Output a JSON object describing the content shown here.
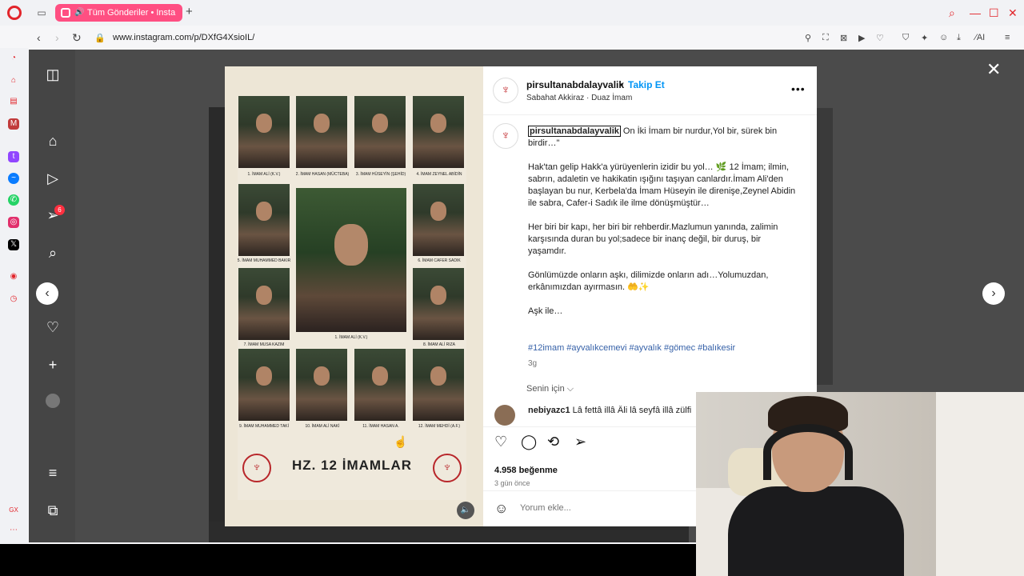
{
  "browser": {
    "tab_title": "Tüm Gönderiler • Insta",
    "url": "www.instagram.com/p/DXfG4XsioIL/",
    "ext_ai_label": "AI",
    "new_tab": "+",
    "notif_badge": "6"
  },
  "post": {
    "username": "pirsultanabdalayvalik",
    "follow_label": "Takip Et",
    "separator": "•",
    "subtitle": "Sabahat Akkiraz · Duaz İmam",
    "caption_start": "On İki İmam bir nurdur,Yol bir, sürek bin birdir…\"",
    "p1": "Hak'tan gelip Hakk'a yürüyenlerin izidir bu yol… 🌿 12 İmam; ilmin, sabrın, adaletin ve hakikatin ışığını taşıyan canlardır.İmam Ali'den başlayan bu nur, Kerbela'da İmam Hüseyin ile direnişe,Zeynel Abidin ile sabra, Cafer-i Sadık ile ilme dönüşmüştür…",
    "p2": "Her biri bir kapı, her biri bir rehberdir.Mazlumun yanında, zalimin karşısında duran bu yol;sadece bir inanç değil, bir duruş, bir yaşamdır.",
    "p3": "Gönlümüzde onların aşkı, dilimizde onların adı…Yolumuzdan, erkânımızdan ayırmasın. 🤲✨",
    "p4": "Aşk ile…",
    "hashtags": "#12imam #ayvalıkcemevi #ayvalık #gömec #balıkesir",
    "age": "3g",
    "for_you": "Senin için ⌵",
    "comment_user": "nebiyazc1",
    "comment_text": "Lâ fettâ illâ Âli lâ seyfâ illâ zülfi",
    "likes": "4.958 beğenme",
    "posted_ago": "3 gün önce",
    "comment_placeholder": "Yorum ekle..."
  },
  "poster": {
    "title": "HZ. 12 İMAMLAR",
    "captions": [
      "1. İMAM ALİ (K.V.)",
      "2. İMAM HASAN (MÜCTEBA)",
      "3. İMAM HÜSEYİN (ŞEHİD)",
      "4. İMAM ZEYNEL ABİDİN",
      "5. İMAM MUHAMMED BAKIR",
      "6. İMAM CAFER SADIK",
      "7. İMAM MUSA KAZIM",
      "8. İMAM ALİ RIZA",
      "9. İMAM MUHAMMED TAKİ",
      "10. İMAM ALİ NAKİ",
      "11. İMAM HASAN A.",
      "12. İMAM MEHDİ (A.F.)"
    ],
    "center_caption": "1. İMAM ALİ (K.V.)"
  },
  "colors": {
    "brand": "#0095f6",
    "tab": "#ff4f82",
    "opera": "#e2252b"
  }
}
